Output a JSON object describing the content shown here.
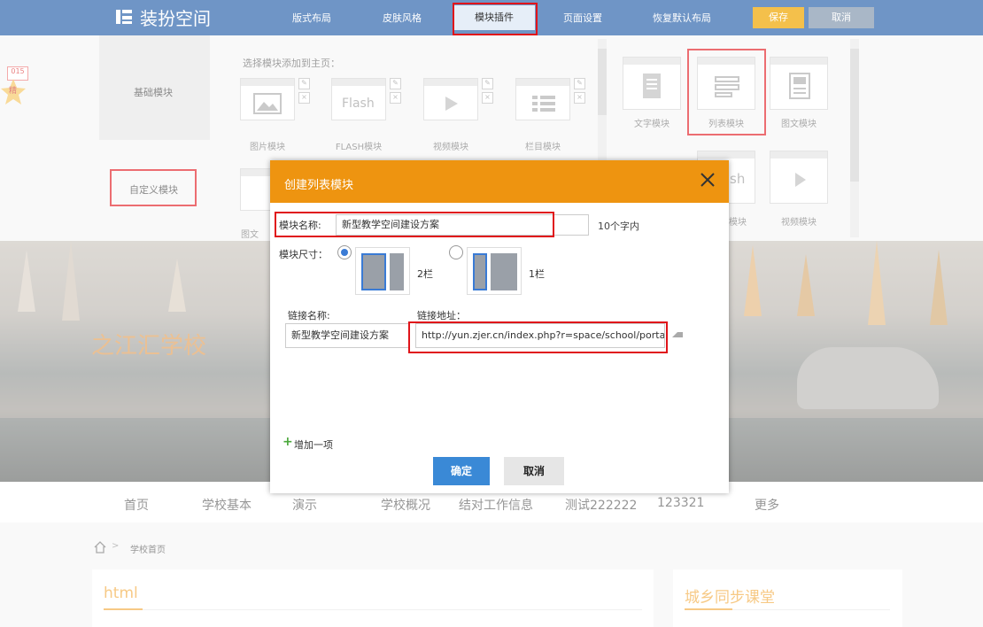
{
  "topbar": {
    "logo_text": "装扮空间",
    "nav": [
      "版式布局",
      "皮肤风格",
      "模块插件",
      "页面设置",
      "恢复默认布局"
    ],
    "save": "保存",
    "cancel": "取消"
  },
  "panel": {
    "category_basic": "基础模块",
    "category_custom": "自定义模块",
    "prompt": "选择模块添加到主页：",
    "basic_modules": [
      "图片模块",
      "FLASH模块",
      "视频模块",
      "栏目模块"
    ],
    "flash_label": "Flash",
    "second_row_partial": "图文",
    "right_modules": [
      "文字模块",
      "列表模块",
      "图文模块"
    ],
    "right_second_row": [
      "模块",
      "视频模块"
    ],
    "right_flash_partial": "sh",
    "side_badge": [
      "015",
      "精"
    ]
  },
  "banner": {
    "school_name": "之江汇学校"
  },
  "menu": [
    "首页",
    "学校基本",
    "演示",
    "学校概况",
    "结对工作信息",
    "测试222222",
    "123321",
    "更多"
  ],
  "breadcrumb": "学校首页",
  "cards": {
    "left_title": "html",
    "right_title": "城乡同步课堂"
  },
  "dialog": {
    "title": "创建列表模块",
    "name_label": "模块名称:",
    "name_value": "新型教学空间建设方案",
    "name_hint": "10个字内",
    "size_label": "模块尺寸：",
    "size_options": [
      "2栏",
      "1栏"
    ],
    "link_name_label": "链接名称:",
    "link_name_value": "新型教学空间建设方案",
    "link_url_label": "链接地址：",
    "link_url_value": "http://yun.zjer.cn/index.php?r=space/school/portal",
    "add_item": "增加一项",
    "ok": "确定",
    "cancel": "取消"
  },
  "colors": {
    "topbar": "#6f95c6",
    "dialog_header": "#ee9410",
    "highlight_box": "#e0141a",
    "ok_button": "#3a89d6",
    "accent_title": "#f2a93b"
  }
}
